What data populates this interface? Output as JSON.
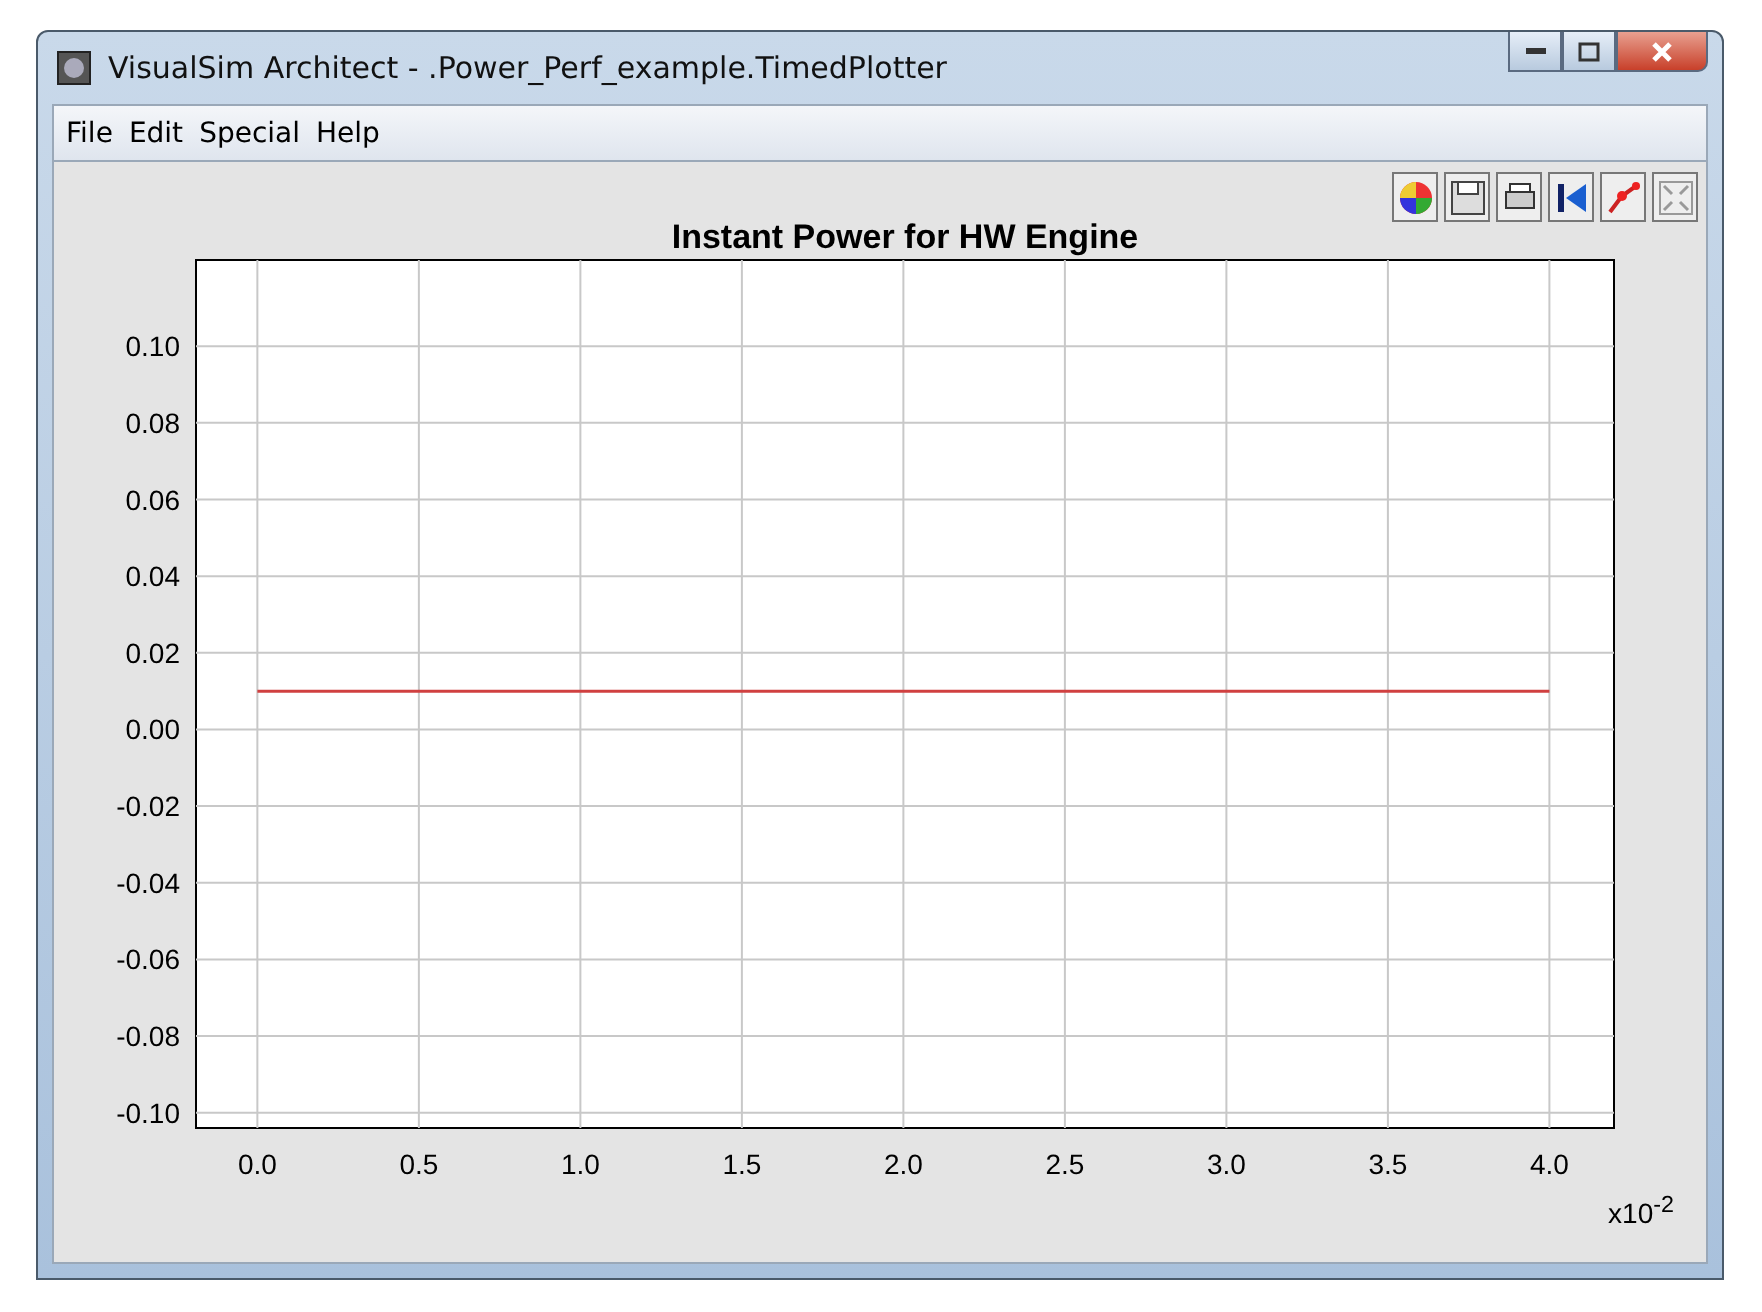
{
  "window": {
    "title": "VisualSim Architect - .Power_Perf_example.TimedPlotter"
  },
  "menu": [
    "File",
    "Edit",
    "Special",
    "Help"
  ],
  "plot": {
    "chart_data": {
      "type": "line",
      "title": "Instant Power for HW Engine",
      "xlabel": "x10$^{-2}$",
      "x": [
        0,
        4
      ],
      "series": [
        {
          "color": "#d04040",
          "values": [
            0.01,
            0.01
          ]
        }
      ],
      "grid": true,
      "xlim": [
        -0.19,
        4.2
      ],
      "ylim": [
        -0.104,
        0.1225
      ],
      "xticks": [
        {
          "value": 0,
          "label": "0.0"
        },
        {
          "value": 0.5,
          "label": "0.5"
        },
        {
          "value": 1,
          "label": "1.0"
        },
        {
          "value": 1.5,
          "label": "1.5"
        },
        {
          "value": 2,
          "label": "2.0"
        },
        {
          "value": 2.5,
          "label": "2.5"
        },
        {
          "value": 3,
          "label": "3.0"
        },
        {
          "value": 3.5,
          "label": "3.5"
        },
        {
          "value": 4,
          "label": "4.0"
        }
      ],
      "yticks": [
        {
          "value": 0.1,
          "label": "0.10"
        },
        {
          "value": 0.08,
          "label": "0.08"
        },
        {
          "value": 0.06,
          "label": "0.06"
        },
        {
          "value": 0.04,
          "label": "0.04"
        },
        {
          "value": 0.02,
          "label": "0.02"
        },
        {
          "value": 0,
          "label": "0.00"
        },
        {
          "value": -0.02,
          "label": "-0.02"
        },
        {
          "value": -0.04,
          "label": "-0.04"
        },
        {
          "value": -0.06,
          "label": "-0.06"
        },
        {
          "value": -0.08,
          "label": "-0.08"
        },
        {
          "value": -0.1,
          "label": "-0.10"
        }
      ]
    }
  }
}
